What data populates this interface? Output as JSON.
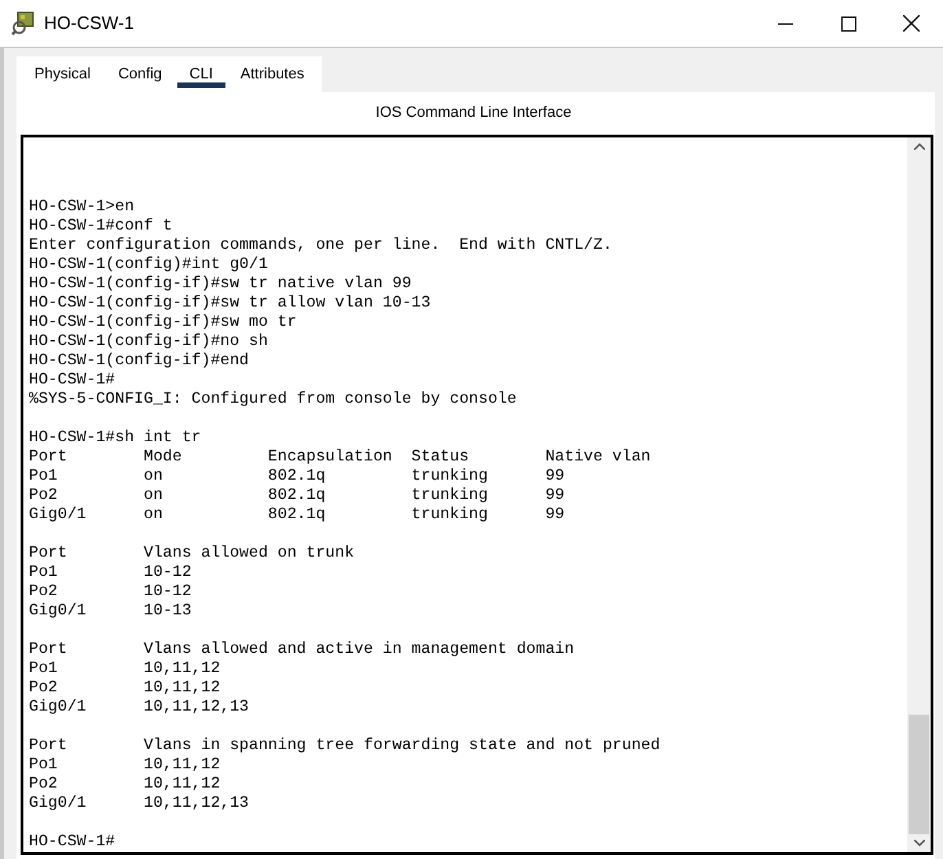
{
  "window": {
    "title": "HO-CSW-1"
  },
  "tabs": [
    {
      "label": "Physical",
      "selected": false
    },
    {
      "label": "Config",
      "selected": false
    },
    {
      "label": "CLI",
      "selected": true
    },
    {
      "label": "Attributes",
      "selected": false
    }
  ],
  "panel_title": "IOS Command Line Interface",
  "terminal": {
    "blocks": [
      [
        "HO-CSW-1>en",
        "HO-CSW-1#conf t",
        "Enter configuration commands, one per line.  End with CNTL/Z.",
        "HO-CSW-1(config)#int g0/1",
        "HO-CSW-1(config-if)#sw tr native vlan 99",
        "HO-CSW-1(config-if)#sw tr allow vlan 10-13",
        "HO-CSW-1(config-if)#sw mo tr",
        "HO-CSW-1(config-if)#no sh",
        "HO-CSW-1(config-if)#end",
        "HO-CSW-1#",
        "%SYS-5-CONFIG_I: Configured from console by console"
      ],
      [
        "HO-CSW-1#sh int tr",
        "Port        Mode         Encapsulation  Status        Native vlan",
        "Po1         on           802.1q         trunking      99",
        "Po2         on           802.1q         trunking      99",
        "Gig0/1      on           802.1q         trunking      99"
      ],
      [
        "Port        Vlans allowed on trunk",
        "Po1         10-12",
        "Po2         10-12",
        "Gig0/1      10-13"
      ],
      [
        "Port        Vlans allowed and active in management domain",
        "Po1         10,11,12",
        "Po2         10,11,12",
        "Gig0/1      10,11,12,13"
      ],
      [
        "Port        Vlans in spanning tree forwarding state and not pruned",
        "Po1         10,11,12",
        "Po2         10,11,12",
        "Gig0/1      10,11,12,13"
      ],
      [
        "HO-CSW-1#"
      ]
    ]
  }
}
